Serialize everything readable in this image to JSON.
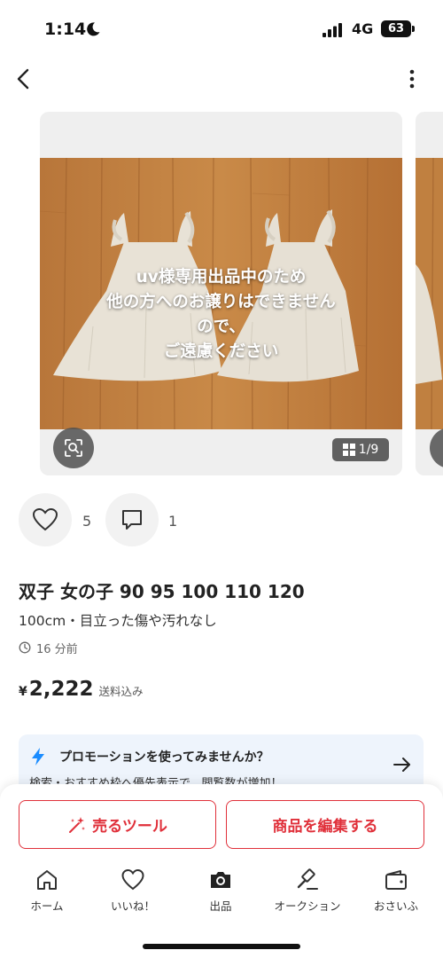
{
  "status_bar": {
    "time": "1:14",
    "network": "4G",
    "battery": "63"
  },
  "carousel": {
    "overlay_lines": [
      "uv様専用出品中のため",
      "他の方へのお譲りはできません",
      "ので、",
      "ご遠慮ください"
    ],
    "page_indicator": "1/9"
  },
  "actions": {
    "like_count": "5",
    "comment_count": "1"
  },
  "item": {
    "title": "双子 女の子 90 95 100 110 120",
    "subtitle": "100cm・目立った傷や汚れなし",
    "posted_time": "16 分前",
    "currency": "¥",
    "price": "2,222",
    "shipping": "送料込み"
  },
  "promo": {
    "title": "プロモーションを使ってみませんか？",
    "description": "検索・おすすめ枠へ優先表示で、閲覧数が増加！"
  },
  "buttons": {
    "sell_tool": "売るツール",
    "edit_item": "商品を編集する"
  },
  "tabs": [
    {
      "label": "ホーム",
      "icon": "home-icon"
    },
    {
      "label": "いいね！",
      "icon": "heart-icon"
    },
    {
      "label": "出品",
      "icon": "camera-icon"
    },
    {
      "label": "オークション",
      "icon": "gavel-icon"
    },
    {
      "label": "おさいふ",
      "icon": "wallet-icon"
    }
  ],
  "colors": {
    "accent": "#e0303a",
    "promo_bg": "#eef4fc",
    "bolt": "#1a8cff"
  }
}
